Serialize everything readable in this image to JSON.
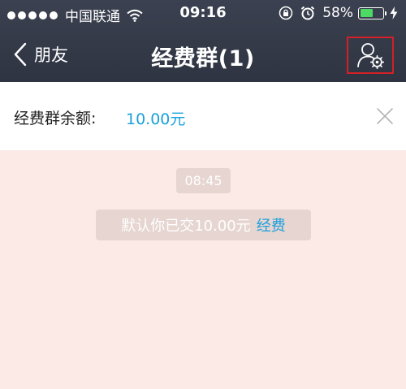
{
  "status_bar": {
    "carrier": "中国联通",
    "time": "09:16",
    "battery_percent_text": "58%",
    "battery_level": 0.58
  },
  "navbar": {
    "back_label": "朋友",
    "title": "经费群(1)"
  },
  "balance": {
    "label": "经费群余额:",
    "value": "10.00元"
  },
  "chat": {
    "timestamp": "08:45",
    "system_message": "默认你已交10.00元",
    "system_link": "经费"
  },
  "colors": {
    "header_bg": "#343946",
    "accent_blue": "#1aa0dc",
    "highlight_red": "#d32026",
    "chat_bg": "#fbeae6"
  },
  "icons": [
    "back-chevron-icon",
    "user-settings-icon",
    "close-icon",
    "wifi-icon",
    "lock-rotation-icon",
    "alarm-icon",
    "charging-bolt-icon"
  ]
}
